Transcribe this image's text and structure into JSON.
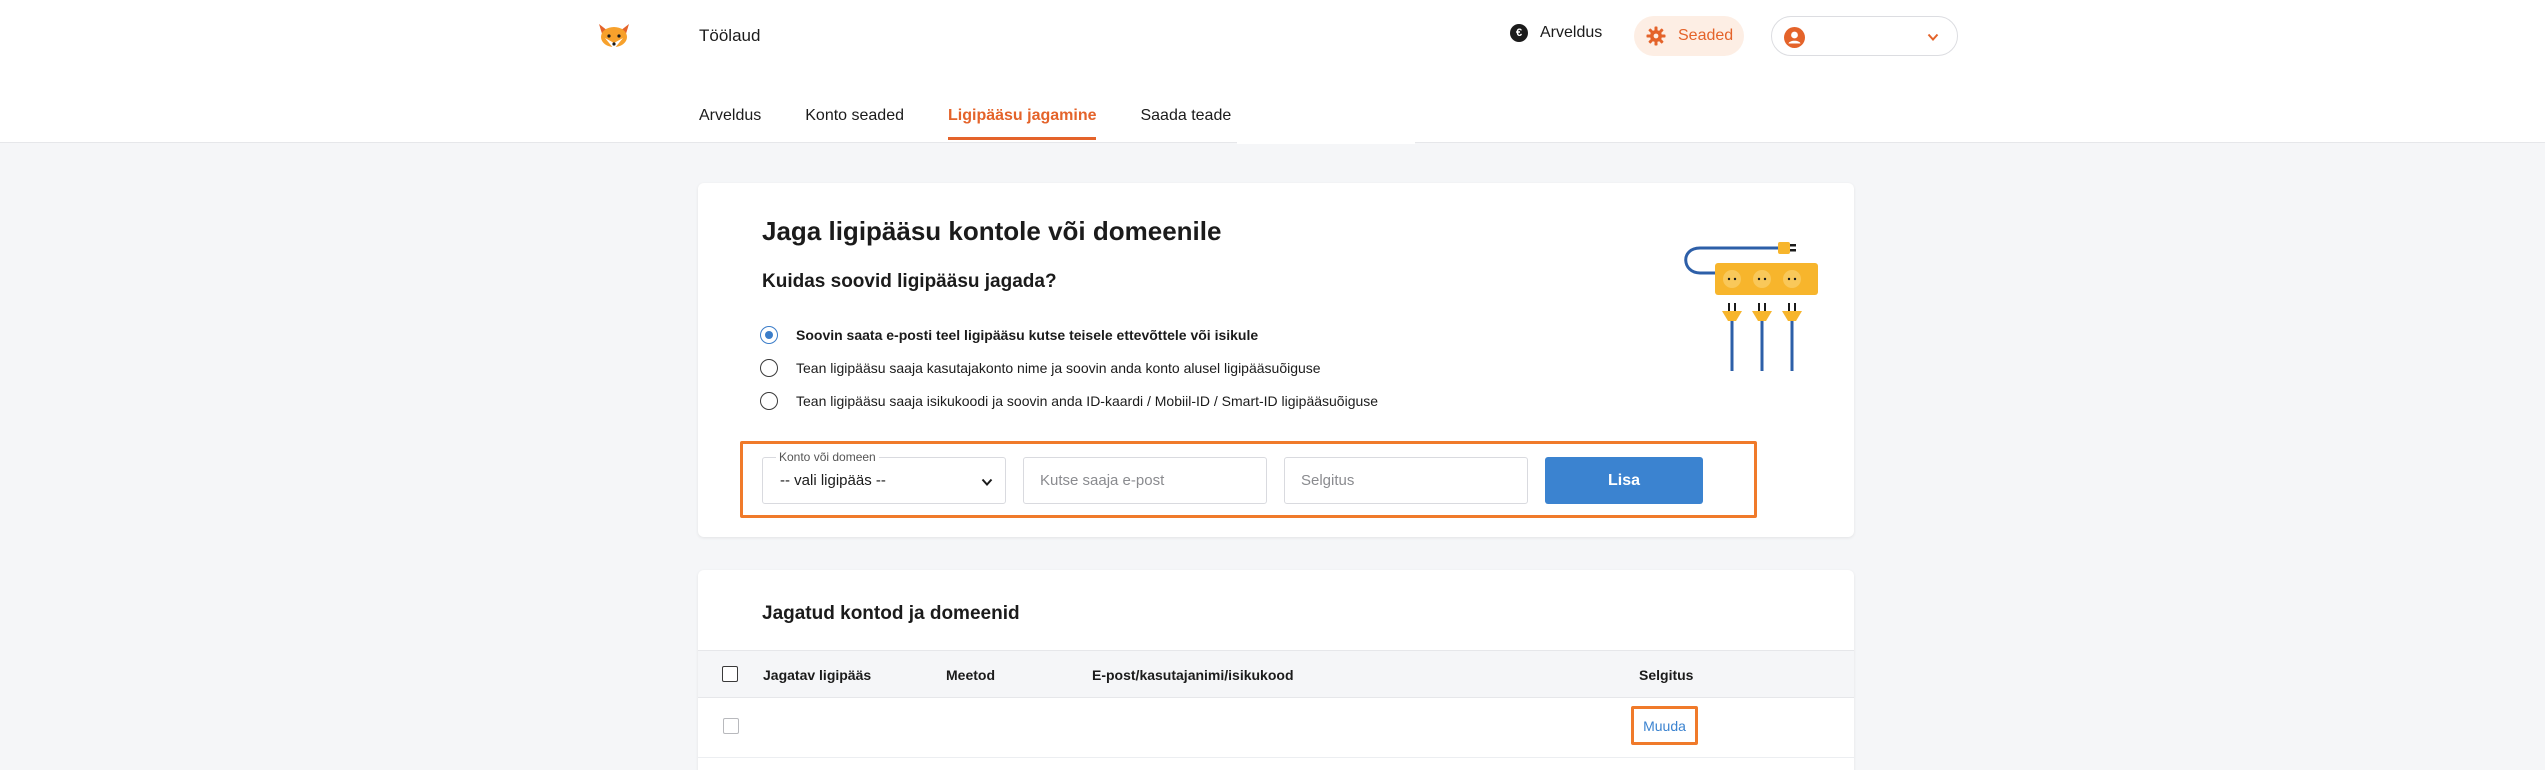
{
  "header": {
    "app_title": "Töölaud",
    "billing_label": "Arveldus",
    "euro_symbol": "€",
    "settings_label": "Seaded"
  },
  "tabs": [
    {
      "label": "Arveldus",
      "active": false
    },
    {
      "label": "Konto seaded",
      "active": false
    },
    {
      "label": "Ligipääsu jagamine",
      "active": true
    },
    {
      "label": "Saada teade",
      "active": false
    }
  ],
  "share": {
    "title": "Jaga ligipääsu kontole või domeenile",
    "subtitle": "Kuidas soovid ligipääsu jagada?",
    "options": [
      {
        "label": "Soovin saata e-posti teel ligipääsu kutse teisele ettevõttele või isikule",
        "checked": true
      },
      {
        "label": "Tean ligipääsu saaja kasutajakonto nime ja soovin anda konto alusel ligipääsuõiguse",
        "checked": false
      },
      {
        "label": "Tean ligipääsu saaja isikukoodi ja soovin anda ID-kaardi / Mobiil-ID / Smart-ID ligipääsuõiguse",
        "checked": false
      }
    ],
    "form": {
      "account_label": "Konto või domeen",
      "account_value": "-- vali ligipääs --",
      "email_placeholder": "Kutse saaja e-post",
      "explanation_placeholder": "Selgitus",
      "add_label": "Lisa"
    }
  },
  "shared": {
    "title": "Jagatud kontod ja domeenid",
    "columns": [
      "Jagatav ligipääs",
      "Meetod",
      "E-post/kasutajanimi/isikukood",
      "Selgitus"
    ],
    "rows": [
      {
        "edit_label": "Muuda"
      }
    ]
  },
  "colors": {
    "accent": "#e4632a",
    "highlight": "#f07a2a",
    "primary": "#3b83d0",
    "illustration_yellow": "#f7b52c"
  },
  "icons": {
    "logo": "fox-logo-icon",
    "billing": "euro-icon",
    "settings": "gear-icon",
    "user": "user-avatar-icon",
    "dropdown": "chevron-down-icon"
  }
}
